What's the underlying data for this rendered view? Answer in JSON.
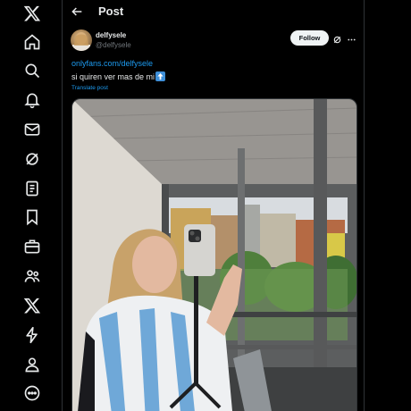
{
  "header": {
    "title": "Post"
  },
  "sidebar": {
    "icons": [
      "x-logo-icon",
      "home-icon",
      "search-icon",
      "notifications-icon",
      "messages-icon",
      "grok-icon",
      "lists-icon",
      "bookmarks-icon",
      "jobs-icon",
      "communities-icon",
      "premium-icon",
      "verified-orgs-icon",
      "profile-icon",
      "more-icon"
    ]
  },
  "post": {
    "author_name": "delfysele",
    "author_handle": "@delfysele",
    "follow_label": "Follow",
    "link": "onlyfans.com/delfysele",
    "text": "si quiren ver mas de mi",
    "translate_label": "Translate post"
  },
  "colors": {
    "accent": "#1d9bf0",
    "background": "#000000",
    "border": "#2f3336"
  }
}
